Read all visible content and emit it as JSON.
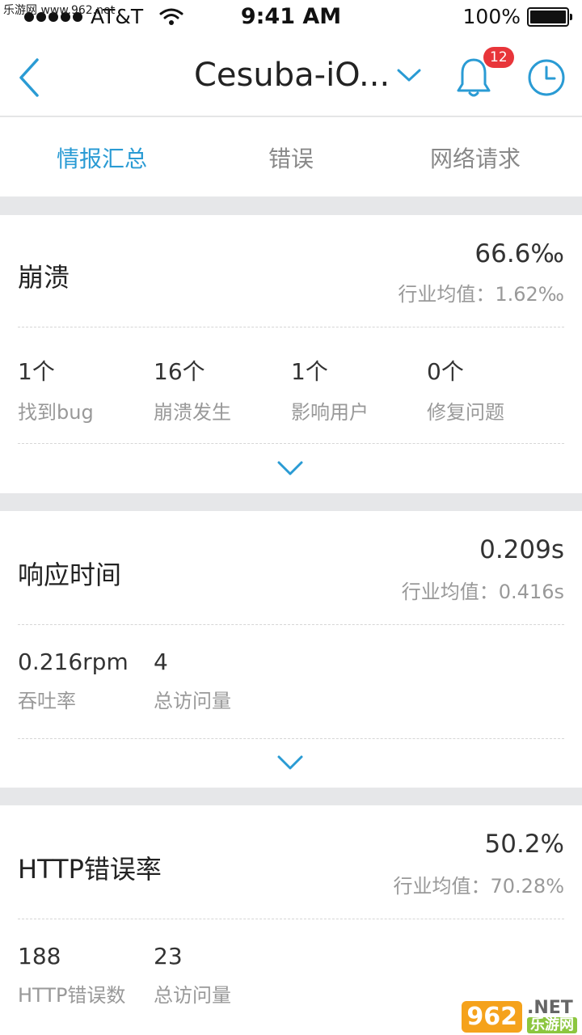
{
  "watermark_top": "乐游网 www.962.net",
  "status": {
    "carrier": "AT&T",
    "time": "9:41 AM",
    "battery": "100%"
  },
  "nav": {
    "title": "Cesuba-iO...",
    "badge_count": "12"
  },
  "tabs": [
    {
      "label": "情报汇总",
      "active": true
    },
    {
      "label": "错误",
      "active": false
    },
    {
      "label": "网络请求",
      "active": false
    }
  ],
  "cards": [
    {
      "title": "崩溃",
      "value": "66.6‰",
      "avg": "行业均值：1.62‰",
      "metrics": [
        {
          "value": "1个",
          "label": "找到bug"
        },
        {
          "value": "16个",
          "label": "崩溃发生"
        },
        {
          "value": "1个",
          "label": "影响用户"
        },
        {
          "value": "0个",
          "label": "修复问题"
        }
      ]
    },
    {
      "title": "响应时间",
      "value": "0.209s",
      "avg": "行业均值：0.416s",
      "metrics": [
        {
          "value": "0.216rpm",
          "label": "吞吐率"
        },
        {
          "value": "4",
          "label": "总访问量"
        }
      ]
    },
    {
      "title": "HTTP错误率",
      "value": "50.2%",
      "avg": "行业均值：70.28%",
      "metrics": [
        {
          "value": "188",
          "label": "HTTP错误数"
        },
        {
          "value": "23",
          "label": "总访问量"
        }
      ]
    }
  ],
  "watermark_br": {
    "logo": "962",
    "net": ".NET",
    "cn": "乐游网"
  },
  "colors": {
    "accent": "#2a9bd4",
    "badge": "#e8353a",
    "background": "#e6e7e9"
  }
}
